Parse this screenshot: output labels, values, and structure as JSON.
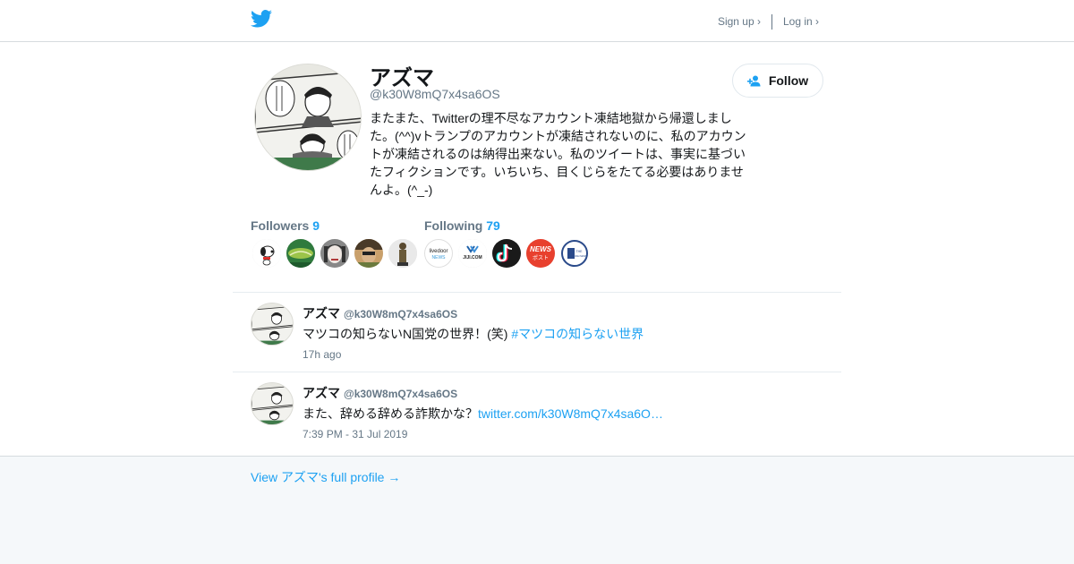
{
  "header": {
    "logo_icon": "twitter-bird-icon",
    "signup_label": "Sign up ›",
    "login_label": "Log in ›"
  },
  "profile": {
    "name": "アズマ",
    "handle": "@k30W8mQ7x4sa6OS",
    "bio": "またまた、Twitterの理不尽なアカウント凍結地獄から帰還しました。(^^)vトランプのアカウントが凍結されないのに、私のアカウントが凍結されるのは納得出来ない。私のツイートは、事実に基づいたフィクションです。いちいち、目くじらをたてる必要はありませんよ。(^_-)",
    "follow_label": "Follow",
    "followers_label": "Followers",
    "followers_count": "9",
    "following_label": "Following",
    "following_count": "79"
  },
  "followers_avatars": [
    "snoopy-avatar",
    "tennis-ball-avatar",
    "woman-portrait-avatar",
    "sunglasses-avatar",
    "statue-avatar"
  ],
  "following_avatars": [
    {
      "name": "livedoor-news-avatar",
      "line1": "livedoor",
      "line2": "NEWS"
    },
    {
      "name": "jiji-com-avatar",
      "line1": "JIJI.COM"
    },
    {
      "name": "tiktok-style-avatar"
    },
    {
      "name": "news-post-avatar",
      "line1": "NEWS",
      "line2": "ポスト"
    },
    {
      "name": "sankei-news-avatar",
      "line1": "THE",
      "line2": "SANKEI NEWS"
    }
  ],
  "tweets": [
    {
      "name": "アズマ",
      "handle": "@k30W8mQ7x4sa6OS",
      "text": "マツコの知らないN国党の世界！(笑) ",
      "link": "#マツコの知らない世界",
      "time": "17h ago"
    },
    {
      "name": "アズマ",
      "handle": "@k30W8mQ7x4sa6OS",
      "text": "また、辞める辞める詐欺かな？",
      "link": "twitter.com/k30W8mQ7x4sa6O…",
      "time": "7:39 PM - 31 Jul 2019"
    }
  ],
  "footer": {
    "full_profile_label": "View アズマ's full profile →"
  },
  "colors": {
    "accent": "#1da1f2",
    "muted": "#657786",
    "text": "#14171a",
    "border": "#e6ecf0",
    "footer_bg": "#f5f8fa"
  }
}
